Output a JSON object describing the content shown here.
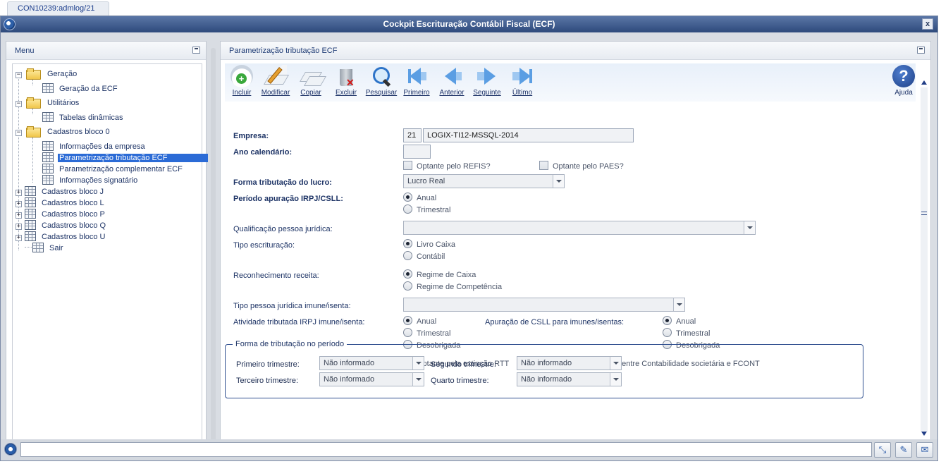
{
  "tab": {
    "label": "CON10239:admlog/21"
  },
  "window": {
    "title": "Cockpit Escrituração Contábil Fiscal (ECF)",
    "close": "x"
  },
  "menu": {
    "title": "Menu",
    "items": [
      {
        "label": "Geração"
      },
      {
        "label": "Geração da ECF"
      },
      {
        "label": "Utilitários"
      },
      {
        "label": "Tabelas dinâmicas"
      },
      {
        "label": "Cadastros bloco 0"
      },
      {
        "label": "Informações da empresa"
      },
      {
        "label": "Parametrização tributação ECF"
      },
      {
        "label": "Parametrização complementar ECF"
      },
      {
        "label": "Informações signatário"
      },
      {
        "label": "Cadastros bloco J"
      },
      {
        "label": "Cadastros bloco L"
      },
      {
        "label": "Cadastros bloco P"
      },
      {
        "label": "Cadastros bloco Q"
      },
      {
        "label": "Cadastros bloco U"
      },
      {
        "label": "Sair"
      }
    ]
  },
  "main": {
    "title": "Parametrização tributação ECF",
    "toolbar": [
      {
        "label": "Incluir"
      },
      {
        "label": "Modificar"
      },
      {
        "label": "Copiar"
      },
      {
        "label": "Excluir"
      },
      {
        "label": "Pesquisar"
      },
      {
        "label": "Primeiro"
      },
      {
        "label": "Anterior"
      },
      {
        "label": "Seguinte"
      },
      {
        "label": "Último"
      },
      {
        "label": "Ajuda"
      }
    ],
    "form": {
      "empresa_label": "Empresa:",
      "empresa_code": "21",
      "empresa_name": "LOGIX-TI12-MSSQL-2014",
      "ano_label": "Ano calendário:",
      "ano_value": "",
      "refis_label": "Optante pelo REFIS?",
      "paes_label": "Optante pelo PAES?",
      "forma_label": "Forma tributação do lucro:",
      "forma_value": "Lucro Real",
      "periodo_label": "Período apuração IRPJ/CSLL:",
      "periodo_anual": "Anual",
      "periodo_trimestral": "Trimestral",
      "qualif_label": "Qualificação pessoa jurídica:",
      "qualif_value": "",
      "tipo_escr_label": "Tipo escrituração:",
      "livro_caixa": "Livro Caixa",
      "contabil": "Contábil",
      "reconh_label": "Reconhecimento receita:",
      "regime_caixa": "Regime de Caixa",
      "regime_competencia": "Regime de Competência",
      "tipo_pj_label": "Tipo pessoa jurídica imune/isenta:",
      "tipo_pj_value": "",
      "atividade_label": "Atividade tributada IRPJ imune/isenta:",
      "ativ_anual": "Anual",
      "ativ_trimestral": "Trimestral",
      "ativ_desobrigada": "Desobrigada",
      "csll_label": "Apuração de CSLL para imunes/isentas:",
      "csll_anual": "Anual",
      "csll_trimestral": "Trimestral",
      "csll_desobrigada": "Desobrigada",
      "rtt_label": "Optante pela extinção RTT",
      "fcont_label": "Diferença entre Contabilidade societária e FCONT",
      "group_title": "Forma de tributação no período",
      "primeiro_label": "Primeiro trimestre:",
      "primeiro_value": "Não informado",
      "segundo_label": "Segundo trimestre:",
      "segundo_value": "Não informado",
      "terceiro_label": "Terceiro trimestre:",
      "terceiro_value": "Não informado",
      "quarto_label": "Quarto trimestre:",
      "quarto_value": "Não informado"
    }
  },
  "statusbar": {
    "message": ""
  }
}
